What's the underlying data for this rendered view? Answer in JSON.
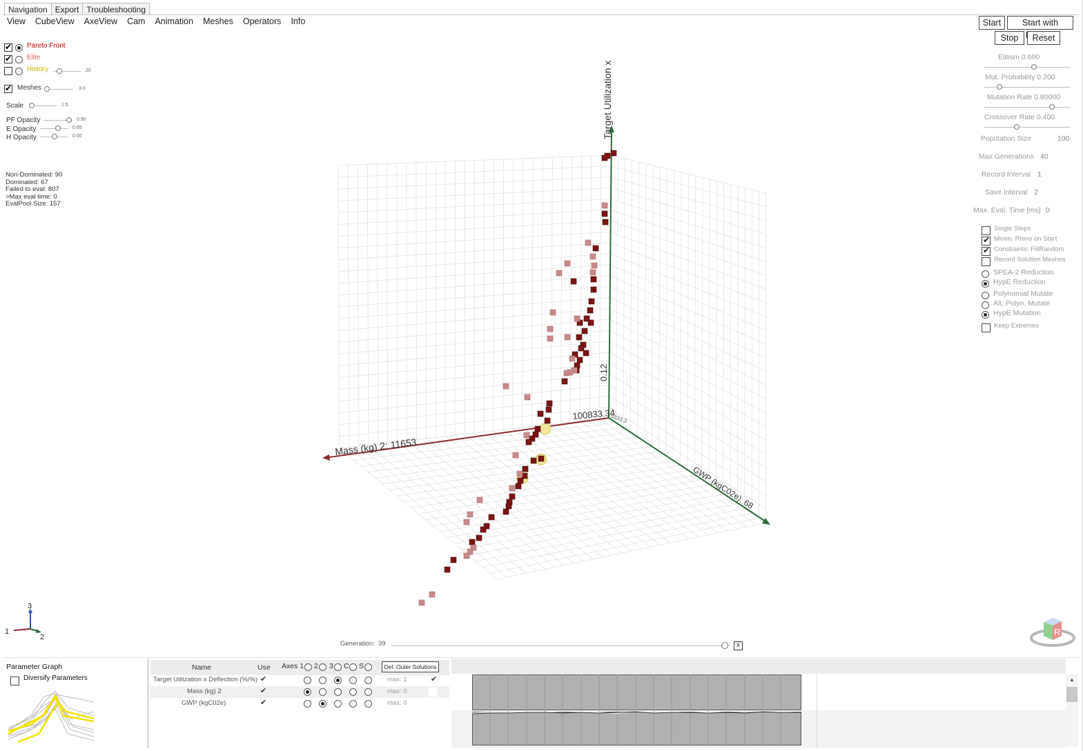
{
  "tabs": [
    "Navigation",
    "Export",
    "Troubleshooting"
  ],
  "menu": [
    "View",
    "CubeView",
    "AxeView",
    "Cam",
    "Animation",
    "Meshes",
    "Operators",
    "Info"
  ],
  "layers": {
    "pareto": {
      "label": "Pareto Front",
      "color": "#c00000"
    },
    "elite": {
      "label": "Elite",
      "color": "#e06060"
    },
    "history": {
      "label": "History",
      "color": "#c8b400",
      "value": "20"
    },
    "meshes": {
      "label": "Meshes",
      "value": "3.0"
    },
    "scale": {
      "label": "Scale",
      "value": "1.5"
    },
    "pf_opacity": {
      "label": "PF Opacity",
      "value": "0.90"
    },
    "e_opacity": {
      "label": "E Opacity",
      "value": "0.65"
    },
    "h_opacity": {
      "label": "H Opacity",
      "value": "0.50"
    }
  },
  "stats": [
    "Non-Dominated: 90",
    "Dominated: 67",
    "Failed to eval: 807",
    ">Max eval time: 0",
    "EvalPool Size: 157"
  ],
  "buttons": {
    "start": "Start",
    "start_presets": "Start with Presets",
    "stop": "Stop",
    "reset": "Reset"
  },
  "params": {
    "elitism": {
      "label": "Elitism",
      "value": "0.600",
      "level": 0.6
    },
    "mut_prob": {
      "label": "Mut. Probability",
      "value": "0.200",
      "level": 0.2
    },
    "mut_rate": {
      "label": "Mutation Rate",
      "value": "0.80000",
      "level": 0.8
    },
    "cross_rate": {
      "label": "Crossover Rate",
      "value": "0.400",
      "level": 0.4
    },
    "pop_size": {
      "label": "Population Size",
      "value": "100"
    },
    "max_gen": {
      "label": "Max Generations",
      "value": "40"
    },
    "rec_int": {
      "label": "Record Interval",
      "value": "1"
    },
    "save_int": {
      "label": "Save Interval",
      "value": "2"
    },
    "max_eval": {
      "label": "Max. Eval. Time [ms]",
      "value": "0"
    }
  },
  "options": {
    "single_steps": "Single Steps",
    "minim_rhino": "Minim. Rhino on Start",
    "constraints": "Constraints: FillRandom",
    "record_meshes": "Record Solution Meshes",
    "spea2": "SPEA-2 Reduction",
    "hype_red": "HypE Reduction",
    "poly_mut": "Polynomial Mutate",
    "alt_poly": "Alt. Polyn. Mutate",
    "hype_mut": "HypE Mutation",
    "keep_ext": "Keep Extremes"
  },
  "plot": {
    "axis_y": "Target Utilization x",
    "axis_x": "Mass (kg) 2: 11653",
    "axis_z": "GWP (kgC02e): 68",
    "tick_y": "0.12",
    "tick_origin": "100833.34",
    "tick_origin2": "5333.3"
  },
  "gizmo": {
    "a1": "1",
    "a2": "2",
    "a3": "3"
  },
  "generation": {
    "label": "Generation:",
    "value": "39",
    "close": "x",
    "level": 0.975
  },
  "param_graph": {
    "title": "Parameter Graph",
    "diversify": "Diversify Parameters"
  },
  "table": {
    "headers": {
      "name": "Name",
      "use": "Use",
      "axes": "Axes",
      "a1": "1",
      "a2": "2",
      "a3": "3",
      "c": "C",
      "s": "S",
      "del": "Del. Outer Solutions"
    },
    "rows": [
      {
        "name": "Target Utilization x Deflection (%/%)",
        "use": "✔",
        "max": "max: 1",
        "check": "✔"
      },
      {
        "name": "Mass (kg) 2",
        "use": "✔",
        "max": "max: 0",
        "check": ""
      },
      {
        "name": "GWP (kgC02e)",
        "use": "✔",
        "max": "max: 0",
        "check": ""
      }
    ]
  }
}
